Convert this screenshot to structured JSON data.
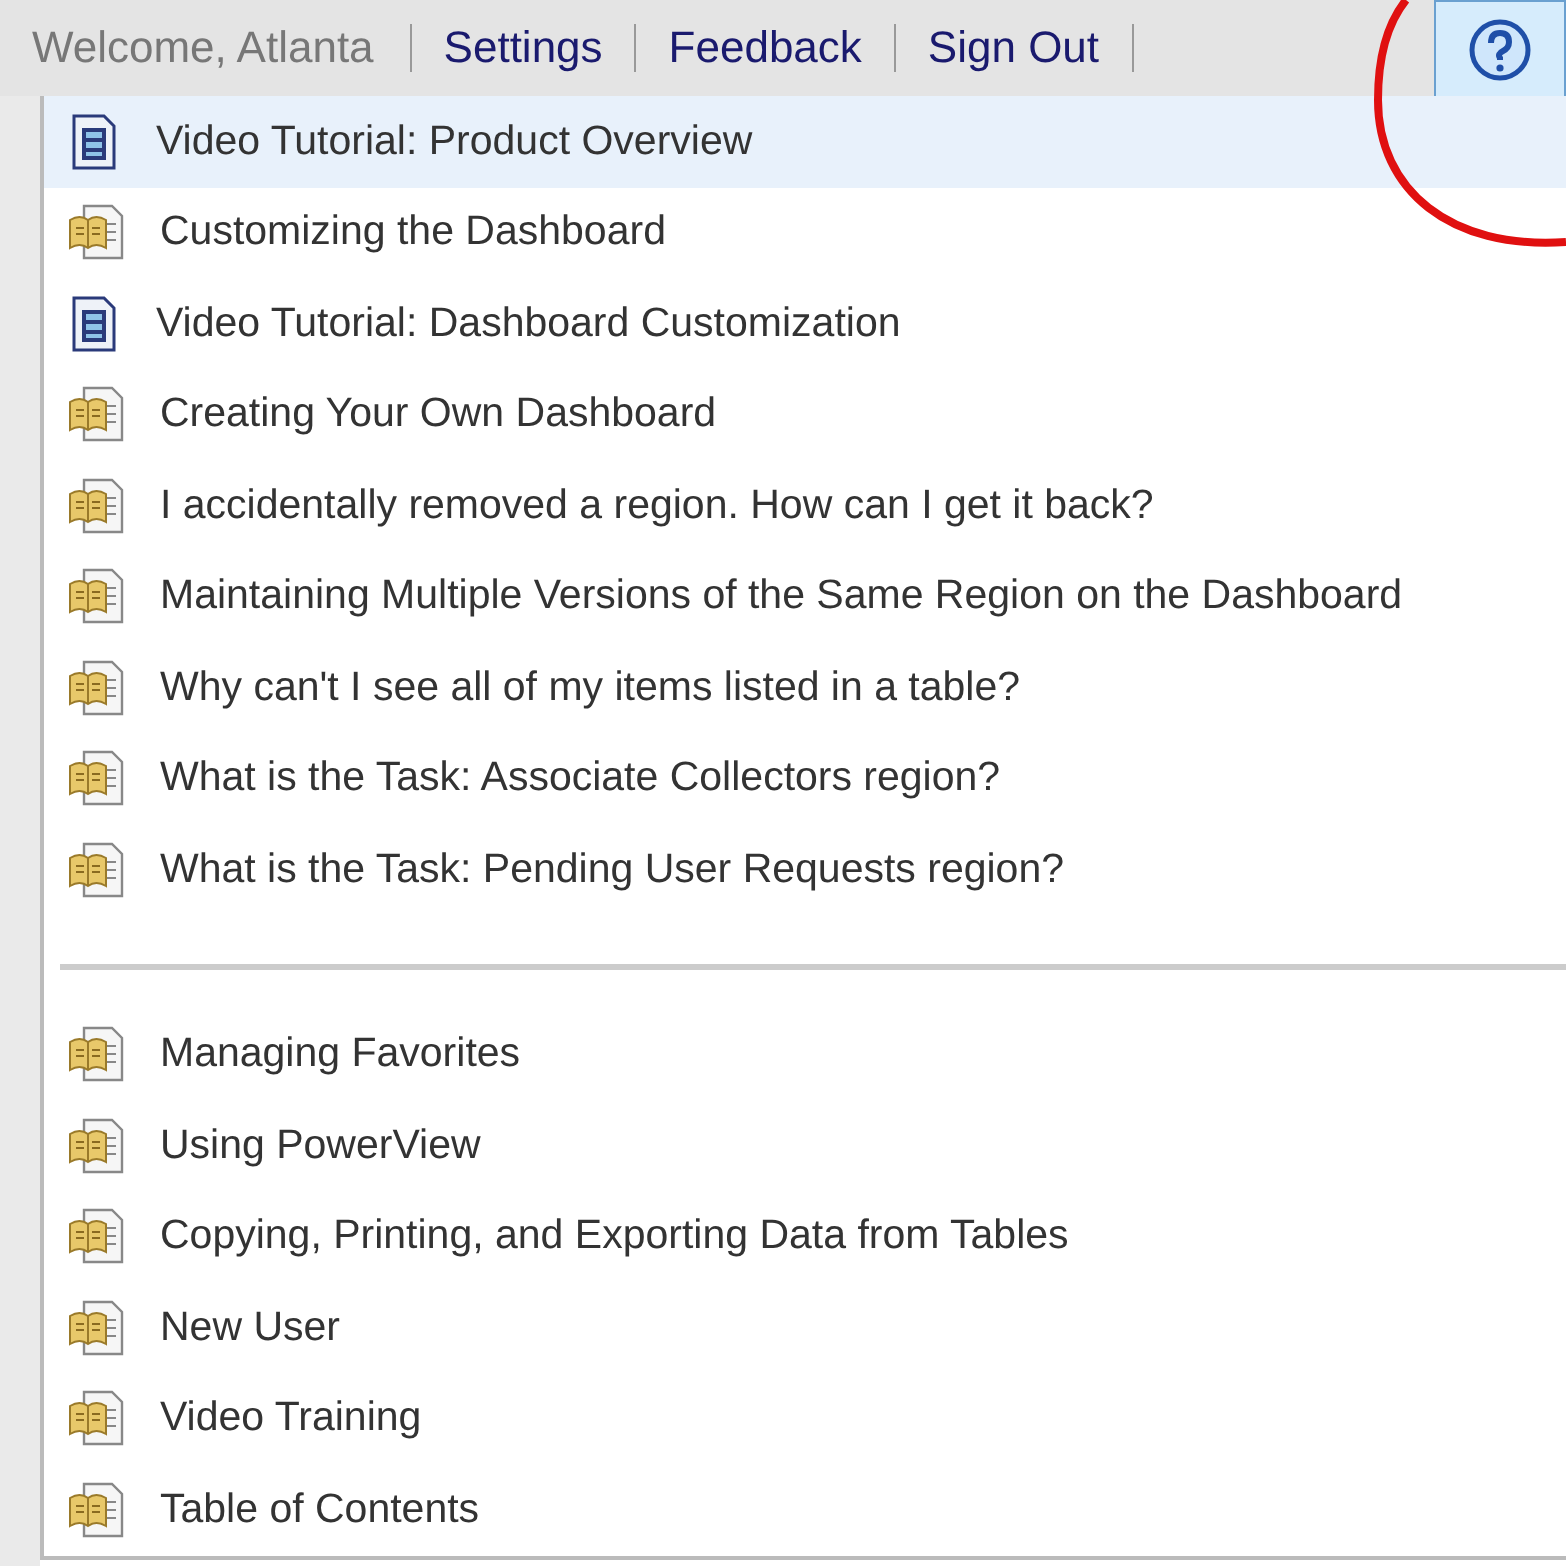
{
  "header": {
    "welcome": "Welcome, Atlanta",
    "links": [
      "Settings",
      "Feedback",
      "Sign Out"
    ],
    "help_button": {
      "selected": true
    }
  },
  "menu": {
    "groups": [
      {
        "items": [
          {
            "kind": "video",
            "label": "Video Tutorial: Product Overview",
            "selected": true
          },
          {
            "kind": "book",
            "label": "Customizing the Dashboard",
            "selected": false
          },
          {
            "kind": "video",
            "label": "Video Tutorial: Dashboard Customization",
            "selected": false
          },
          {
            "kind": "book",
            "label": "Creating Your Own Dashboard",
            "selected": false
          },
          {
            "kind": "book",
            "label": "I accidentally removed a region. How can I get it back?",
            "selected": false
          },
          {
            "kind": "book",
            "label": "Maintaining Multiple Versions of the Same Region on the Dashboard",
            "selected": false
          },
          {
            "kind": "book",
            "label": "Why can't I see all of my items listed in a table?",
            "selected": false
          },
          {
            "kind": "book",
            "label": "What is the Task: Associate Collectors region?",
            "selected": false
          },
          {
            "kind": "book",
            "label": "What is the Task: Pending User Requests region?",
            "selected": false
          }
        ]
      },
      {
        "items": [
          {
            "kind": "book",
            "label": "Managing Favorites",
            "selected": false
          },
          {
            "kind": "book",
            "label": "Using PowerView",
            "selected": false
          },
          {
            "kind": "book",
            "label": "Copying, Printing, and Exporting Data from Tables",
            "selected": false
          },
          {
            "kind": "book",
            "label": "New User",
            "selected": false
          },
          {
            "kind": "book",
            "label": "Video Training",
            "selected": false
          },
          {
            "kind": "book",
            "label": "Table of Contents",
            "selected": false
          }
        ]
      }
    ]
  }
}
